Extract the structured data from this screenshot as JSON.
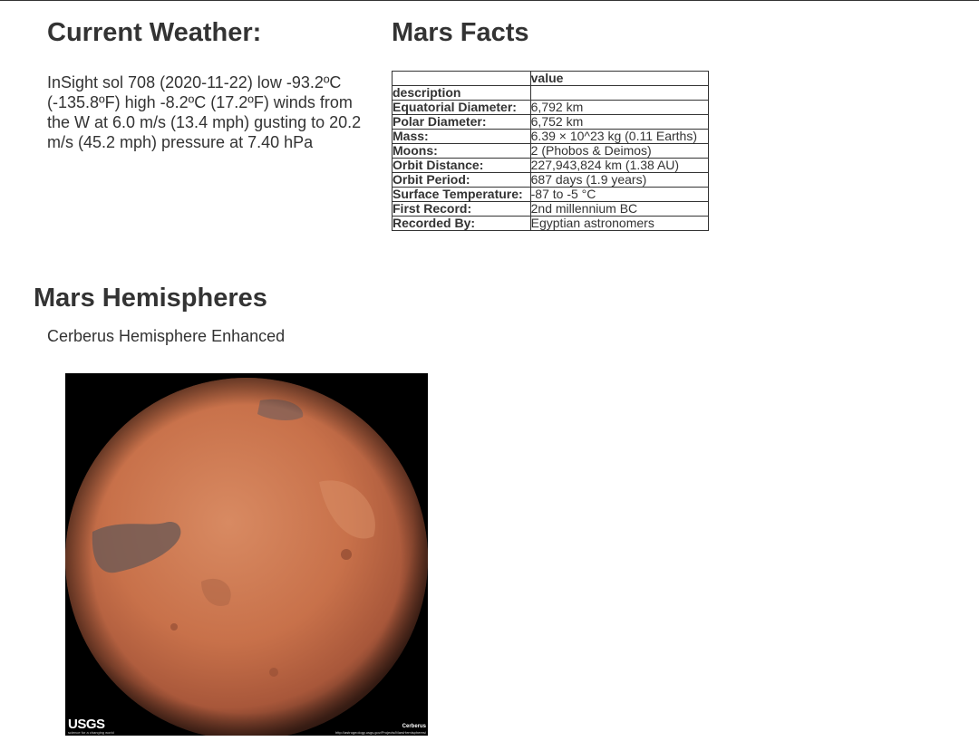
{
  "weather": {
    "title": "Current Weather:",
    "report": "InSight sol 708 (2020-11-22) low -93.2ºC (-135.8ºF) high -8.2ºC (17.2ºF) winds from the W at 6.0 m/s (13.4 mph) gusting to 20.2 m/s (45.2 mph) pressure at 7.40 hPa"
  },
  "facts": {
    "title": "Mars Facts",
    "header": [
      "",
      "value"
    ],
    "index_label": "description",
    "rows": [
      {
        "label": "Equatorial Diameter:",
        "value": "6,792 km"
      },
      {
        "label": "Polar Diameter:",
        "value": "6,752 km"
      },
      {
        "label": "Mass:",
        "value": "6.39 × 10^23 kg (0.11 Earths)"
      },
      {
        "label": "Moons:",
        "value": "2 (Phobos & Deimos)"
      },
      {
        "label": "Orbit Distance:",
        "value": "227,943,824 km (1.38 AU)"
      },
      {
        "label": "Orbit Period:",
        "value": "687 days (1.9 years)"
      },
      {
        "label": "Surface Temperature:",
        "value": "-87 to -5 °C"
      },
      {
        "label": "First Record:",
        "value": "2nd millennium BC"
      },
      {
        "label": "Recorded By:",
        "value": "Egyptian astronomers"
      }
    ]
  },
  "hemispheres": {
    "title": "Mars Hemispheres",
    "items": [
      {
        "caption": "Cerberus Hemisphere Enhanced",
        "image_logo": "USGS",
        "image_logo_sub": "science for a changing world",
        "image_label": "Cerberus",
        "image_url_text": "http://astrogeology.usgs.gov/Projects/MarsHemispheres/"
      }
    ]
  },
  "colors": {
    "text": "#333333",
    "mars_base": "#c8714a",
    "mars_dark": "#6e5a55",
    "background": "#ffffff",
    "image_background": "#000000"
  }
}
